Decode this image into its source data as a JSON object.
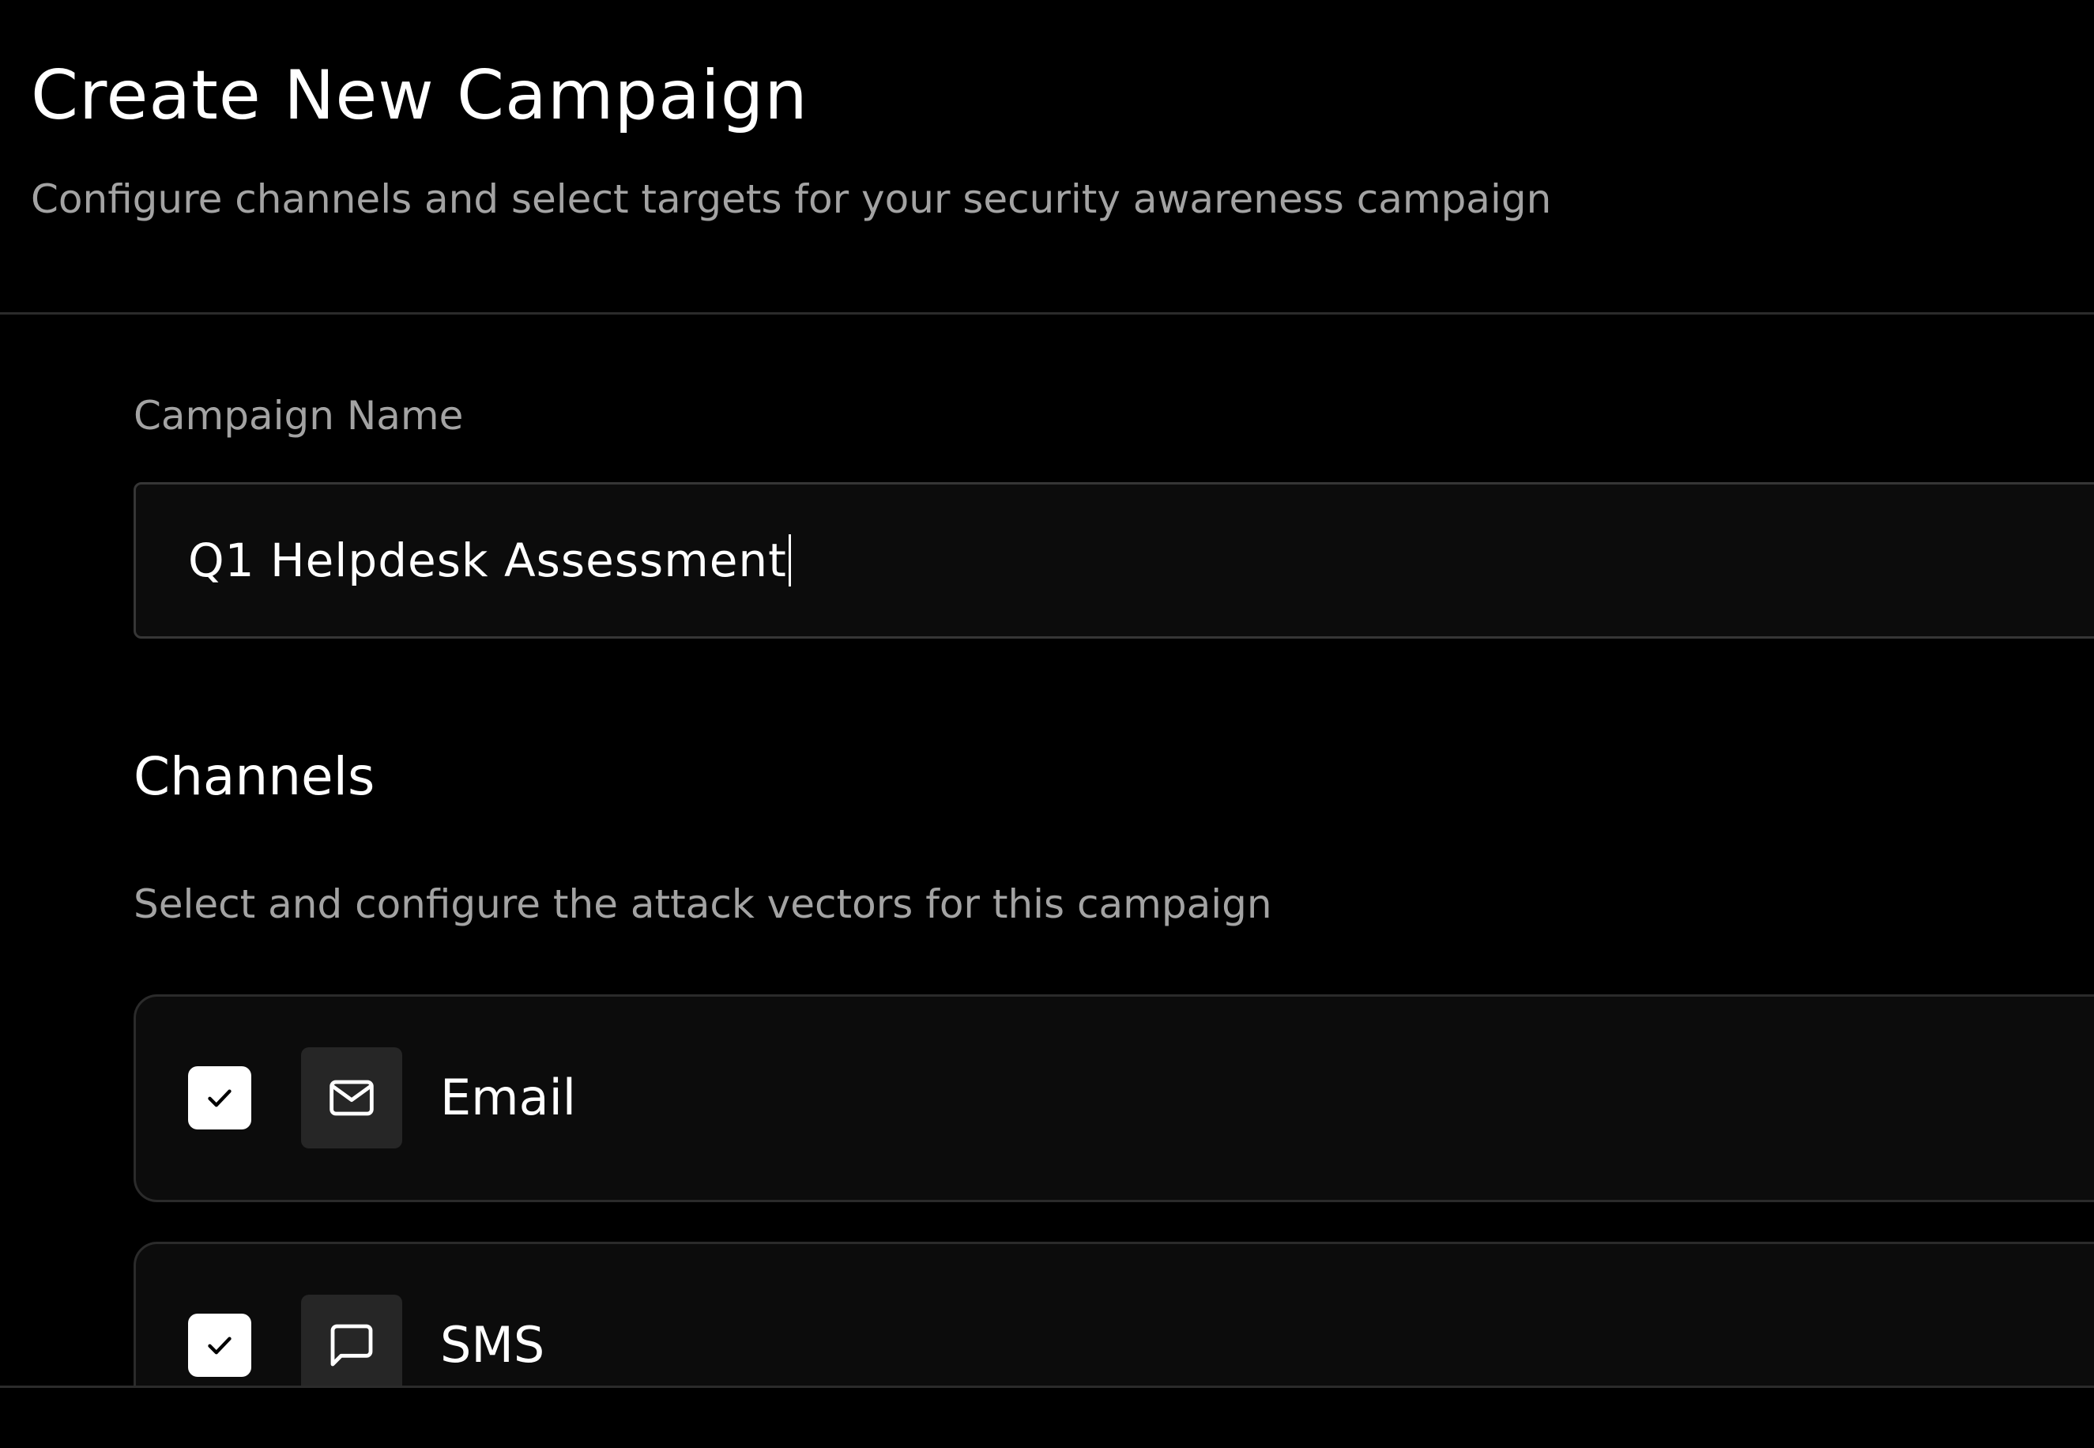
{
  "header": {
    "title": "Create New Campaign",
    "subtitle": "Configure channels and select targets for your security awareness campaign"
  },
  "form": {
    "campaign_name_label": "Campaign Name",
    "campaign_name_value": "Q1 Helpdesk Assessment"
  },
  "channels": {
    "title": "Channels",
    "description": "Select and configure the attack vectors for this campaign",
    "items": [
      {
        "label": "Email",
        "checked": true,
        "icon": "mail-icon"
      },
      {
        "label": "SMS",
        "checked": true,
        "icon": "message-square-icon"
      }
    ]
  },
  "colors": {
    "background": "#000000",
    "card_background": "#0c0c0c",
    "border": "#2b2b2b",
    "muted_text": "#a3a3a3",
    "icon_tile": "#262626",
    "checkbox_fill": "#ffffff"
  }
}
